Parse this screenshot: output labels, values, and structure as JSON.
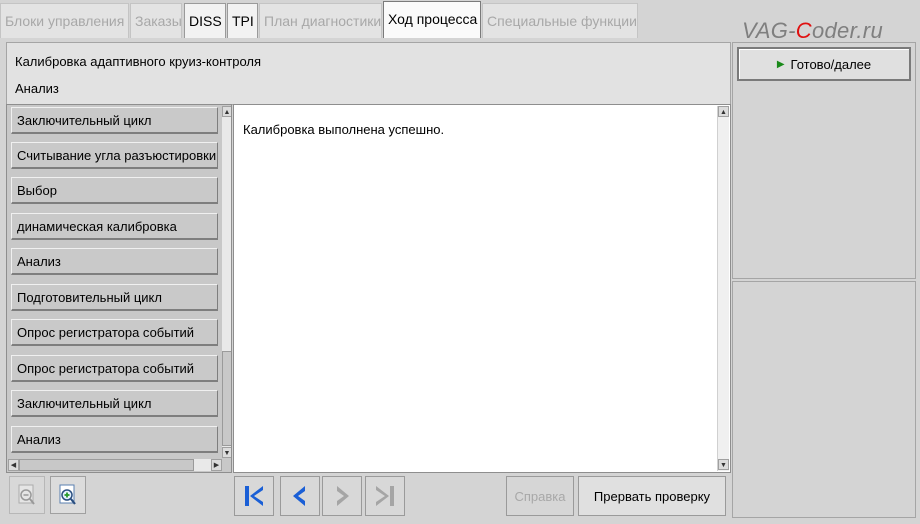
{
  "tabs": [
    {
      "label": "Блоки управления"
    },
    {
      "label": "Заказы"
    },
    {
      "label": "DISS"
    },
    {
      "label": "TPI"
    },
    {
      "label": "План диагностики"
    },
    {
      "label": "Ход процесса"
    },
    {
      "label": "Специальные функции"
    }
  ],
  "watermark": {
    "prefix": "VAG-",
    "accent": "C",
    "suffix": "oder.ru"
  },
  "header": {
    "title": "Калибровка адаптивного круиз-контроля",
    "subtitle": "Анализ"
  },
  "steps": [
    {
      "label": "Заключительный цикл"
    },
    {
      "label": "Считывание угла разъюстировки"
    },
    {
      "label": "Выбор"
    },
    {
      "label": "динамическая калибровка"
    },
    {
      "label": "Анализ"
    },
    {
      "label": "Подготовительный цикл"
    },
    {
      "label": "Опрос регистратора событий"
    },
    {
      "label": "Опрос регистратора событий"
    },
    {
      "label": "Заключительный цикл"
    },
    {
      "label": "Анализ"
    }
  ],
  "content": {
    "message": "Калибровка выполнена успешно."
  },
  "buttons": {
    "done": "Готово/далее",
    "help": "Справка",
    "abort": "Прервать проверку"
  },
  "icons": {
    "zoom_out": "zoom-out-icon",
    "zoom_in": "zoom-in-icon",
    "first": "skip-to-first-icon",
    "back": "chevron-left-icon",
    "forward": "chevron-right-icon",
    "last": "skip-to-last-icon",
    "play": "play-icon"
  },
  "colors": {
    "accent_blue": "#1a5fd6",
    "play_green": "#1a8a1a",
    "watermark_red": "#e01010"
  }
}
